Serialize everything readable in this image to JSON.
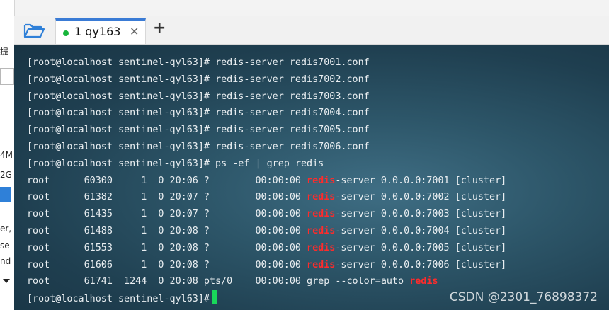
{
  "left_fragments": [
    "提",
    "4M",
    "2G",
    "er,",
    "se",
    "nd"
  ],
  "tab": {
    "title": "1  qy163",
    "close": "✕",
    "add": "+"
  },
  "terminal": {
    "lines": [
      {
        "segments": [
          {
            "t": "[root@localhost sentinel-qyl63]# redis-server redis7001.conf"
          }
        ]
      },
      {
        "segments": [
          {
            "t": "[root@localhost sentinel-qyl63]# redis-server redis7002.conf"
          }
        ]
      },
      {
        "segments": [
          {
            "t": "[root@localhost sentinel-qyl63]# redis-server redis7003.conf"
          }
        ]
      },
      {
        "segments": [
          {
            "t": "[root@localhost sentinel-qyl63]# redis-server redis7004.conf"
          }
        ]
      },
      {
        "segments": [
          {
            "t": "[root@localhost sentinel-qyl63]# redis-server redis7005.conf"
          }
        ]
      },
      {
        "segments": [
          {
            "t": "[root@localhost sentinel-qyl63]# redis-server redis7006.conf"
          }
        ]
      },
      {
        "segments": [
          {
            "t": "[root@localhost sentinel-qyl63]# ps -ef | grep redis"
          }
        ]
      },
      {
        "segments": [
          {
            "t": "root      60300     1  0 20:06 ?        00:00:00 "
          },
          {
            "t": "redis",
            "hl": true
          },
          {
            "t": "-server 0.0.0.0:7001 [cluster]"
          }
        ]
      },
      {
        "segments": [
          {
            "t": "root      61382     1  0 20:07 ?        00:00:00 "
          },
          {
            "t": "redis",
            "hl": true
          },
          {
            "t": "-server 0.0.0.0:7002 [cluster]"
          }
        ]
      },
      {
        "segments": [
          {
            "t": "root      61435     1  0 20:07 ?        00:00:00 "
          },
          {
            "t": "redis",
            "hl": true
          },
          {
            "t": "-server 0.0.0.0:7003 [cluster]"
          }
        ]
      },
      {
        "segments": [
          {
            "t": "root      61488     1  0 20:08 ?        00:00:00 "
          },
          {
            "t": "redis",
            "hl": true
          },
          {
            "t": "-server 0.0.0.0:7004 [cluster]"
          }
        ]
      },
      {
        "segments": [
          {
            "t": "root      61553     1  0 20:08 ?        00:00:00 "
          },
          {
            "t": "redis",
            "hl": true
          },
          {
            "t": "-server 0.0.0.0:7005 [cluster]"
          }
        ]
      },
      {
        "segments": [
          {
            "t": "root      61606     1  0 20:08 ?        00:00:00 "
          },
          {
            "t": "redis",
            "hl": true
          },
          {
            "t": "-server 0.0.0.0:7006 [cluster]"
          }
        ]
      },
      {
        "segments": [
          {
            "t": "root      61741  1244  0 20:08 pts/0    00:00:00 grep --color=auto "
          },
          {
            "t": "redis",
            "hl": true
          }
        ]
      },
      {
        "segments": [
          {
            "t": "[root@localhost sentinel-qyl63]#"
          }
        ],
        "cursor": true
      }
    ],
    "watermark": "CSDN @2301_76898372"
  },
  "colors": {
    "tab_accent": "#3a7bd5",
    "status_dot": "#17b53a",
    "highlight": "#ff2b2b",
    "cursor": "#19d85a"
  },
  "icons": {
    "folder": "folder-open-icon",
    "status": "connected-status-icon"
  }
}
